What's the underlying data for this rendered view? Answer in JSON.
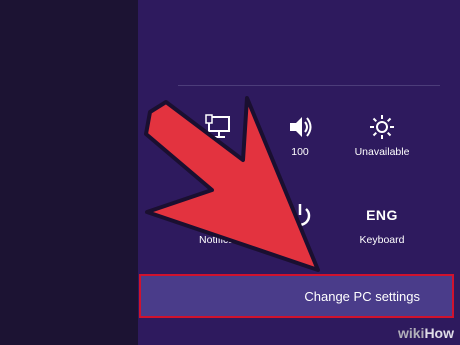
{
  "tiles_row1": [
    {
      "name": "network-tile",
      "icon": "network-icon",
      "label": ""
    },
    {
      "name": "volume-tile",
      "icon": "speaker-icon",
      "label": "100"
    },
    {
      "name": "brightness-tile",
      "icon": "sun-icon",
      "label": "Unavailable"
    }
  ],
  "tiles_row2": [
    {
      "name": "notifications-tile",
      "icon": "notifications-icon",
      "label": "Notificat"
    },
    {
      "name": "power-tile",
      "icon": "power-icon",
      "label": "er"
    },
    {
      "name": "keyboard-tile",
      "icon": "keyboard-text",
      "label": "Keyboard",
      "icon_text": "ENG"
    }
  ],
  "settings_button": {
    "label": "Change PC settings"
  },
  "watermark": {
    "part1": "wiki",
    "part2": "How"
  },
  "colors": {
    "charm_bg": "#2e1a5e",
    "highlight_border": "#d0122e",
    "arrow": "#e3333f"
  }
}
